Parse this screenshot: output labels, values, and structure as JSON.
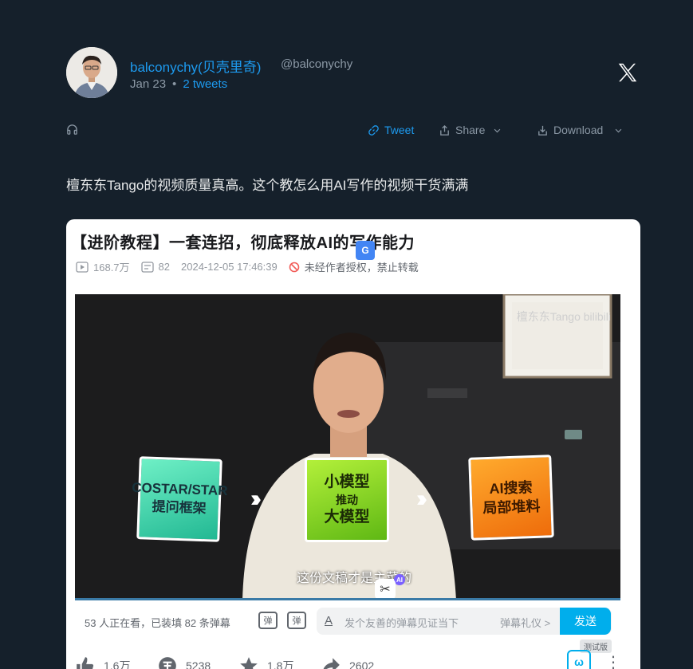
{
  "author": {
    "display_name": "balconychy(贝壳里奇)",
    "handle": "@balconychy",
    "date": "Jan 23",
    "thread_count": "2 tweets"
  },
  "toolbar": {
    "tweet_label": "Tweet",
    "share_label": "Share",
    "download_label": "Download"
  },
  "tweet_text": "檀东东Tango的视频质量真高。这个教怎么用AI写作的视频干货满满",
  "video_card": {
    "title": "【进阶教程】一套连招，彻底释放AI的写作能力",
    "views": "168.7万",
    "danmaku_total": "82",
    "published": "2024-12-05 17:46:39",
    "rights_notice": "未经作者授权，禁止转载",
    "watermark": "檀东东Tango bilibili",
    "boxes": [
      {
        "line1": "COSTAR/STAR",
        "line2": "提问框架"
      },
      {
        "line1": "小模型",
        "line2": "推动",
        "line3": "大模型"
      },
      {
        "line1": "AI搜索",
        "line2": "局部堆料"
      }
    ],
    "subtitle": "这份文稿才是主菜的",
    "ai_badge": "AI",
    "danmaku_status": "53 人正在看，已装填 82 条弹幕",
    "danmaku_icon1": "弹",
    "danmaku_icon2": "弹",
    "danmaku_placeholder": "发个友善的弹幕见证当下",
    "danmaku_etiquette": "弹幕礼仪 >",
    "send_label": "发送",
    "beta_label": "测试版",
    "likes": "1.6万",
    "coins": "5238",
    "favorites": "1.8万",
    "shares": "2602"
  },
  "colors": {
    "background": "#15202b",
    "link": "#1d9bf0",
    "muted": "#8b98a5",
    "bili_blue": "#00aeec"
  }
}
